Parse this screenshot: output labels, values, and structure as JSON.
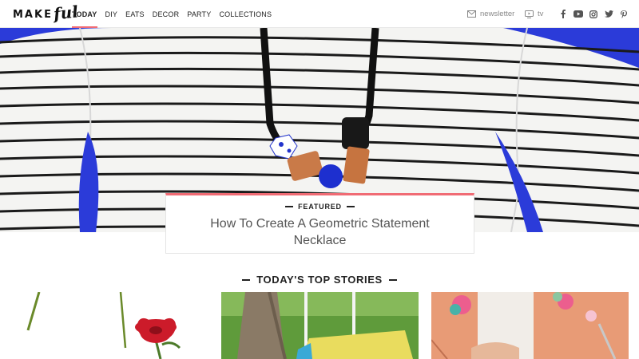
{
  "nav": {
    "logo_main": "MAKE",
    "logo_script": "ful",
    "items": [
      {
        "label": "TODAY",
        "active": true
      },
      {
        "label": "DIY",
        "active": false
      },
      {
        "label": "EATS",
        "active": false
      },
      {
        "label": "DECOR",
        "active": false
      },
      {
        "label": "PARTY",
        "active": false
      },
      {
        "label": "COLLECTIONS",
        "active": false
      }
    ],
    "newsletter_label": "newsletter",
    "tv_label": "tv",
    "social": [
      "facebook-icon",
      "youtube-icon",
      "instagram-icon",
      "twitter-icon",
      "pinterest-icon"
    ]
  },
  "featured": {
    "label": "FEATURED",
    "title": "How To Create A Geometric Statement Necklace"
  },
  "top_stories": {
    "title": "TODAY'S TOP STORIES"
  },
  "colors": {
    "accent": "#f06b74",
    "hero_background": "#2b3bd9"
  }
}
